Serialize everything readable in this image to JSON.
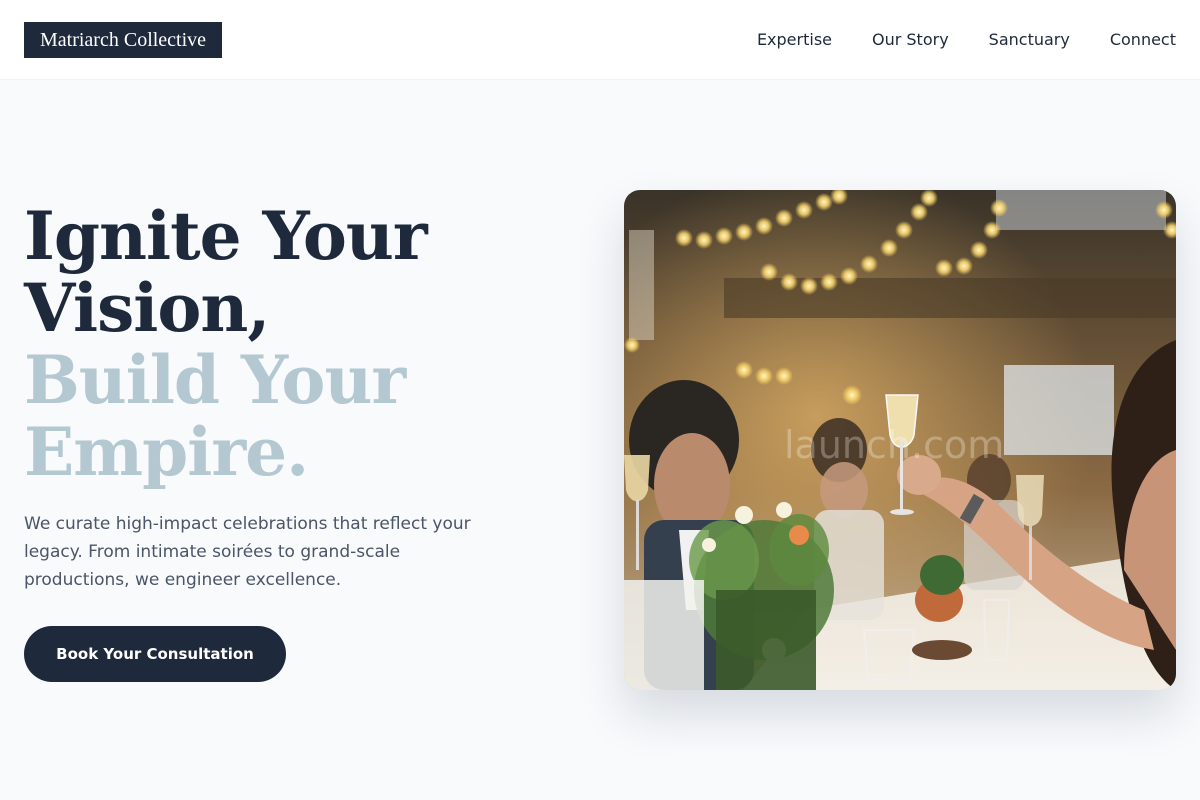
{
  "brand": {
    "name": "Matriarch Collective"
  },
  "nav": {
    "items": [
      "Expertise",
      "Our Story",
      "Sanctuary",
      "Connect"
    ]
  },
  "hero": {
    "title_line1": "Ignite Your",
    "title_line2": "Vision,",
    "title_line3": "Build Your",
    "title_line4": "Empire.",
    "description": "We curate high-impact celebrations that reflect your legacy. From intimate soirées to grand-scale productions, we engineer excellence.",
    "cta_label": "Book Your Consultation",
    "watermark": "launch.com"
  },
  "colors": {
    "primary_dark": "#1e293b",
    "accent_light": "#b3c8d1",
    "background": "#f8fafc"
  }
}
